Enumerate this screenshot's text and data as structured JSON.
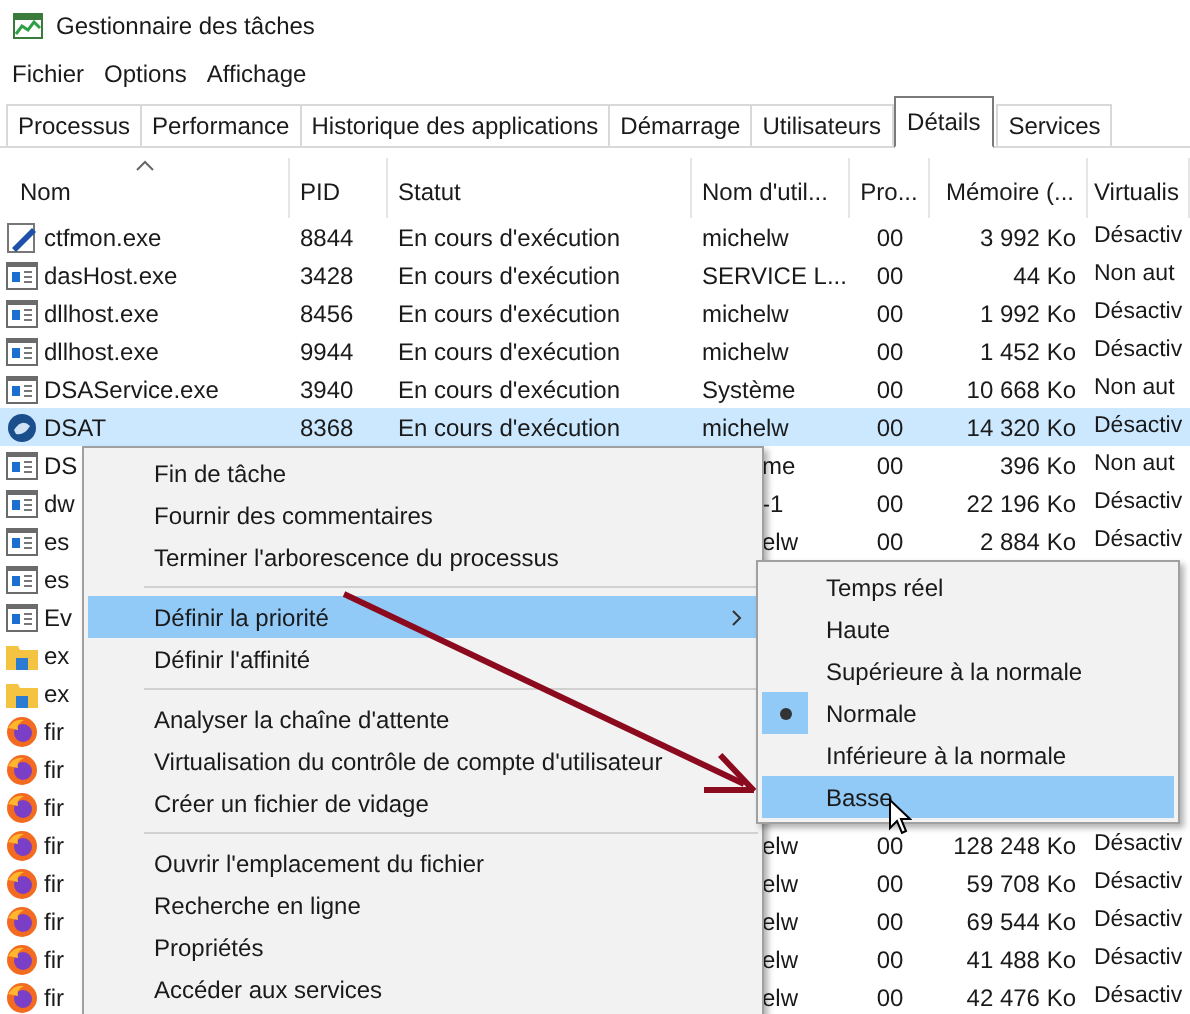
{
  "window": {
    "title": "Gestionnaire des tâches"
  },
  "menu_bar": [
    "Fichier",
    "Options",
    "Affichage"
  ],
  "tabs": [
    {
      "label": "Processus",
      "selected": false
    },
    {
      "label": "Performance",
      "selected": false
    },
    {
      "label": "Historique des applications",
      "selected": false
    },
    {
      "label": "Démarrage",
      "selected": false
    },
    {
      "label": "Utilisateurs",
      "selected": false
    },
    {
      "label": "Détails",
      "selected": true
    },
    {
      "label": "Services",
      "selected": false
    }
  ],
  "table": {
    "columns": [
      {
        "label": "Nom",
        "sorted": true
      },
      {
        "label": "PID",
        "sorted": false
      },
      {
        "label": "Statut",
        "sorted": false
      },
      {
        "label": "Nom d'util...",
        "sorted": false
      },
      {
        "label": "Pro...",
        "sorted": false
      },
      {
        "label": "Mémoire (...",
        "sorted": false
      },
      {
        "label": "Virtualis",
        "sorted": false
      }
    ],
    "rows": [
      {
        "kind": "editor",
        "selected": false,
        "covered": false,
        "cells": [
          "ctfmon.exe",
          "8844",
          "En cours d'exécution",
          "michelw",
          "00",
          "3 992 Ko",
          "Désactiv"
        ]
      },
      {
        "kind": "app",
        "selected": false,
        "covered": false,
        "cells": [
          "dasHost.exe",
          "3428",
          "En cours d'exécution",
          "SERVICE L...",
          "00",
          "44 Ko",
          "Non aut"
        ]
      },
      {
        "kind": "app",
        "selected": false,
        "covered": false,
        "cells": [
          "dllhost.exe",
          "8456",
          "En cours d'exécution",
          "michelw",
          "00",
          "1 992 Ko",
          "Désactiv"
        ]
      },
      {
        "kind": "app",
        "selected": false,
        "covered": false,
        "cells": [
          "dllhost.exe",
          "9944",
          "En cours d'exécution",
          "michelw",
          "00",
          "1 452 Ko",
          "Désactiv"
        ]
      },
      {
        "kind": "app",
        "selected": false,
        "covered": false,
        "cells": [
          "DSAService.exe",
          "3940",
          "En cours d'exécution",
          "Système",
          "00",
          "10 668 Ko",
          "Non aut"
        ]
      },
      {
        "kind": "service",
        "selected": true,
        "covered": false,
        "cells": [
          "DSAT",
          "8368",
          "En cours d'exécution",
          "michelw",
          "00",
          "14 320 Ko",
          "Désactiv"
        ]
      },
      {
        "kind": "app",
        "selected": false,
        "covered": true,
        "cells": [
          "DS",
          null,
          null,
          "me",
          "00",
          "396 Ko",
          "Non aut"
        ]
      },
      {
        "kind": "app",
        "selected": false,
        "covered": true,
        "cells": [
          "dw",
          null,
          null,
          "-1",
          "00",
          "22 196 Ko",
          "Désactiv"
        ]
      },
      {
        "kind": "app",
        "selected": false,
        "covered": true,
        "cells": [
          "es",
          null,
          null,
          "elw",
          "00",
          "2 884 Ko",
          "Désactiv"
        ]
      },
      {
        "kind": "app",
        "selected": false,
        "cells": [
          "es",
          null,
          null,
          null,
          null,
          null,
          null
        ]
      },
      {
        "kind": "app",
        "selected": false,
        "cells": [
          "Ev",
          null,
          null,
          null,
          null,
          null,
          null
        ]
      },
      {
        "kind": "explorer",
        "selected": false,
        "cells": [
          "ex",
          null,
          null,
          null,
          null,
          null,
          null
        ]
      },
      {
        "kind": "explorer",
        "selected": false,
        "cells": [
          "ex",
          null,
          null,
          null,
          null,
          null,
          null
        ]
      },
      {
        "kind": "browser",
        "selected": false,
        "cells": [
          "fir",
          null,
          null,
          null,
          null,
          null,
          null
        ]
      },
      {
        "kind": "browser",
        "selected": false,
        "cells": [
          "fir",
          null,
          null,
          null,
          null,
          null,
          null
        ]
      },
      {
        "kind": "browser",
        "selected": false,
        "cells": [
          "fir",
          null,
          null,
          null,
          null,
          null,
          null
        ]
      },
      {
        "kind": "browser",
        "selected": false,
        "covered": true,
        "cells": [
          "fir",
          null,
          null,
          "elw",
          "00",
          "128 248 Ko",
          "Désactiv"
        ]
      },
      {
        "kind": "browser",
        "selected": false,
        "covered": true,
        "cells": [
          "fir",
          null,
          null,
          "elw",
          "00",
          "59 708 Ko",
          "Désactiv"
        ]
      },
      {
        "kind": "browser",
        "selected": false,
        "covered": true,
        "cells": [
          "fir",
          null,
          null,
          "elw",
          "00",
          "69 544 Ko",
          "Désactiv"
        ]
      },
      {
        "kind": "browser",
        "selected": false,
        "covered": true,
        "cells": [
          "fir",
          null,
          null,
          "elw",
          "00",
          "41 488 Ko",
          "Désactiv"
        ]
      },
      {
        "kind": "browser",
        "selected": false,
        "covered": true,
        "cells": [
          "fir",
          null,
          null,
          "elw",
          "00",
          "42 476 Ko",
          "Désactiv"
        ]
      }
    ]
  },
  "context_menu": {
    "groups": [
      [
        {
          "label": "Fin de tâche",
          "selected": false,
          "has_submenu": false
        },
        {
          "label": "Fournir des commentaires",
          "selected": false,
          "has_submenu": false
        },
        {
          "label": "Terminer l'arborescence du processus",
          "selected": false,
          "has_submenu": false
        }
      ],
      [
        {
          "label": "Définir la priorité",
          "selected": true,
          "has_submenu": true
        },
        {
          "label": "Définir l'affinité",
          "selected": false,
          "has_submenu": false
        }
      ],
      [
        {
          "label": "Analyser la chaîne d'attente",
          "selected": false,
          "has_submenu": false
        },
        {
          "label": "Virtualisation du contrôle de compte d'utilisateur",
          "selected": false,
          "has_submenu": false
        },
        {
          "label": "Créer un fichier de vidage",
          "selected": false,
          "has_submenu": false
        }
      ],
      [
        {
          "label": "Ouvrir l'emplacement du fichier",
          "selected": false,
          "has_submenu": false
        },
        {
          "label": "Recherche en ligne",
          "selected": false,
          "has_submenu": false
        },
        {
          "label": "Propriétés",
          "selected": false,
          "has_submenu": false
        },
        {
          "label": "Accéder aux services",
          "selected": false,
          "has_submenu": false
        }
      ]
    ]
  },
  "submenu": {
    "items": [
      {
        "label": "Temps réel",
        "checked": false,
        "selected": false
      },
      {
        "label": "Haute",
        "checked": false,
        "selected": false
      },
      {
        "label": "Supérieure à la normale",
        "checked": false,
        "selected": false
      },
      {
        "label": "Normale",
        "checked": true,
        "selected": false
      },
      {
        "label": "Inférieure à la normale",
        "checked": false,
        "selected": false
      },
      {
        "label": "Basse",
        "checked": false,
        "selected": true
      }
    ]
  }
}
